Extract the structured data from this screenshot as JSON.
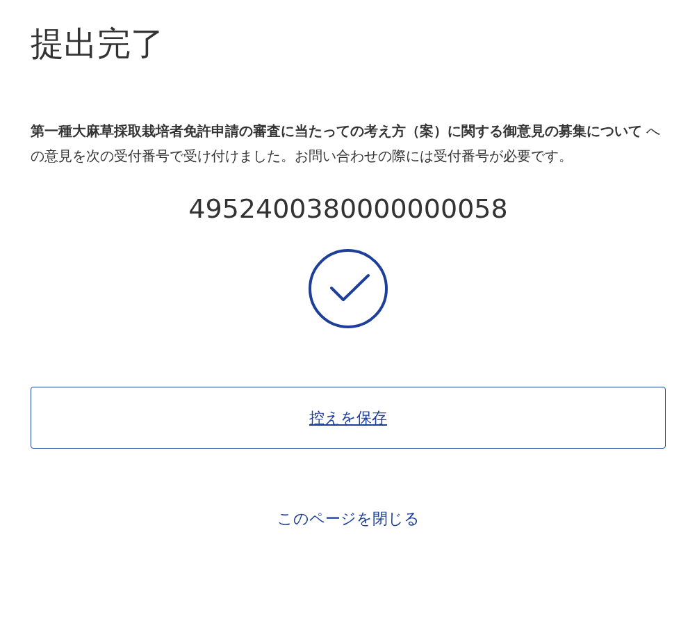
{
  "title": "提出完了",
  "message": "**第一種大麻草採取栽培者免許申請の審査に当たっての考え方（案）に関する御意見の募集について** への意見を次の受付番号で受け付けました。お問い合わせの際には受付番号が必要です。",
  "receipt_number": "4952400380000000058",
  "save_button": "控えを保存",
  "close_link": "このページを閉じる"
}
